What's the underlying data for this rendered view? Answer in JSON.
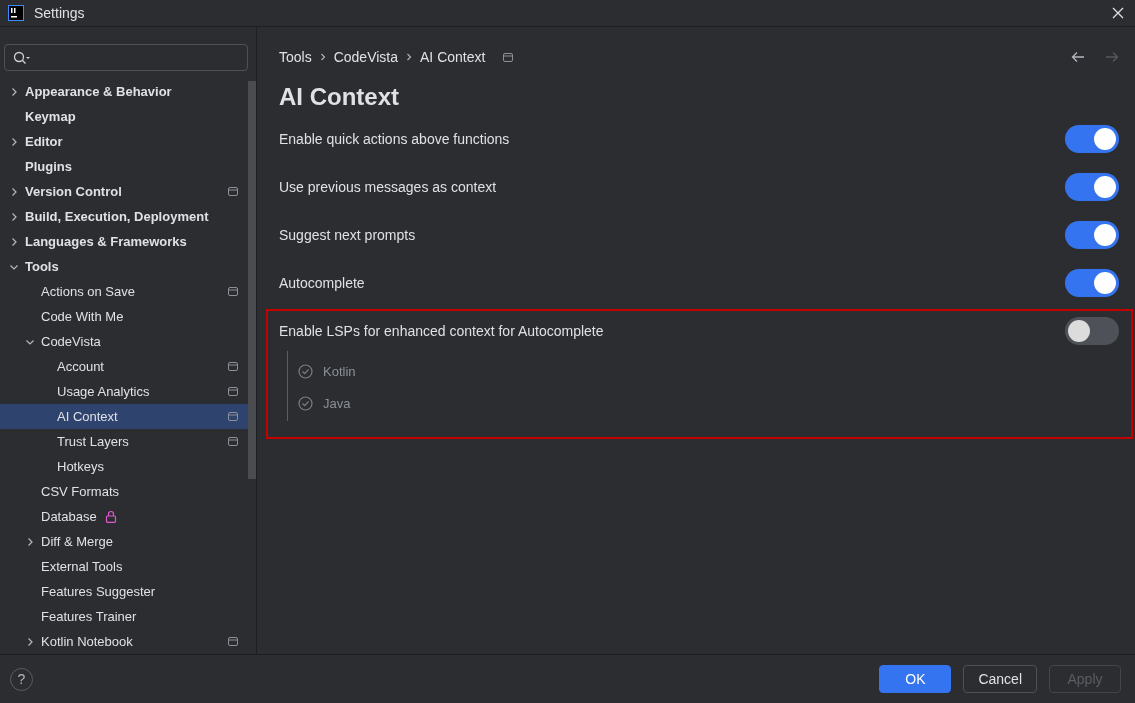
{
  "window": {
    "title": "Settings"
  },
  "sidebar": {
    "items": [
      {
        "label": "Appearance & Behavior",
        "kind": "plain",
        "expanded": false,
        "selected": false
      },
      {
        "label": "Keymap",
        "kind": "plain",
        "selected": false
      },
      {
        "label": "Editor",
        "kind": "plain",
        "expanded": false,
        "selected": false
      },
      {
        "label": "Plugins",
        "kind": "plain",
        "selected": false
      },
      {
        "label": "Version Control",
        "kind": "project",
        "expanded": false,
        "selected": false
      },
      {
        "label": "Build, Execution, Deployment",
        "kind": "plain",
        "expanded": false,
        "selected": false
      },
      {
        "label": "Languages & Frameworks",
        "kind": "plain",
        "expanded": false,
        "selected": false
      },
      {
        "label": "Tools",
        "kind": "plain",
        "expanded": true,
        "selected": false,
        "children": [
          {
            "label": "Actions on Save",
            "kind": "project",
            "selected": false
          },
          {
            "label": "Code With Me",
            "kind": "plain",
            "selected": false
          },
          {
            "label": "CodeVista",
            "kind": "plain",
            "expanded": true,
            "selected": false,
            "children": [
              {
                "label": "Account",
                "kind": "project",
                "selected": false
              },
              {
                "label": "Usage Analytics",
                "kind": "project",
                "selected": false
              },
              {
                "label": "AI Context",
                "kind": "project",
                "selected": true
              },
              {
                "label": "Trust Layers",
                "kind": "project",
                "selected": false
              },
              {
                "label": "Hotkeys",
                "kind": "plain",
                "selected": false
              }
            ]
          },
          {
            "label": "CSV Formats",
            "kind": "plain",
            "selected": false
          },
          {
            "label": "Database",
            "kind": "locked",
            "selected": false
          },
          {
            "label": "Diff & Merge",
            "kind": "plain",
            "expanded": false,
            "selected": false
          },
          {
            "label": "External Tools",
            "kind": "plain",
            "selected": false
          },
          {
            "label": "Features Suggester",
            "kind": "plain",
            "selected": false
          },
          {
            "label": "Features Trainer",
            "kind": "plain",
            "selected": false
          },
          {
            "label": "Kotlin Notebook",
            "kind": "project",
            "expanded": false,
            "selected": false
          }
        ]
      }
    ]
  },
  "breadcrumbs": [
    "Tools",
    "CodeVista",
    "AI Context"
  ],
  "page": {
    "title": "AI Context",
    "settings": [
      {
        "label": "Enable quick actions above functions",
        "on": true,
        "highlighted": false
      },
      {
        "label": "Use previous messages as context",
        "on": true,
        "highlighted": false
      },
      {
        "label": "Suggest next prompts",
        "on": true,
        "highlighted": false
      },
      {
        "label": "Autocomplete",
        "on": true,
        "highlighted": false
      },
      {
        "label": "Enable LSPs for enhanced context for Autocomplete",
        "on": false,
        "highlighted": true,
        "options": [
          {
            "label": "Kotlin",
            "checked": true,
            "disabled": true
          },
          {
            "label": "Java",
            "checked": true,
            "disabled": true
          }
        ]
      }
    ]
  },
  "help": "?",
  "buttons": [
    {
      "label": "OK",
      "kind": "primary",
      "disabled": false
    },
    {
      "label": "Cancel",
      "kind": "secondary",
      "disabled": false
    },
    {
      "label": "Apply",
      "kind": "secondary",
      "disabled": true
    }
  ]
}
